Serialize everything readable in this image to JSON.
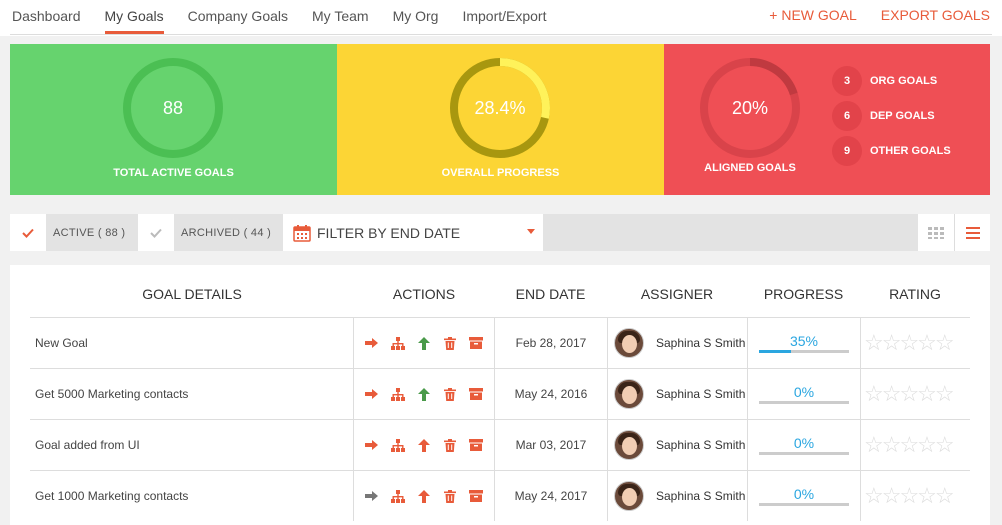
{
  "nav": {
    "tabs": [
      {
        "label": "Dashboard"
      },
      {
        "label": "My Goals"
      },
      {
        "label": "Company Goals"
      },
      {
        "label": "My Team"
      },
      {
        "label": "My Org"
      },
      {
        "label": "Import/Export"
      }
    ],
    "active_tab": "My Goals",
    "new_goal_label": "+ NEW GOAL",
    "export_goals_label": "EXPORT GOALS",
    "accent_color": "#e85b3a"
  },
  "stats": {
    "total_active": {
      "value": "88",
      "caption": "TOTAL ACTIVE GOALS",
      "color": "#66d36e"
    },
    "overall_progress": {
      "value": "28.4%",
      "fraction": 0.284,
      "caption": "OVERALL PROGRESS",
      "color": "#fcd535"
    },
    "aligned": {
      "value": "20%",
      "fraction": 0.2,
      "caption": "ALIGNED GOALS",
      "color": "#ef4f55"
    },
    "aligned_breakdown": [
      {
        "count": "3",
        "label": "ORG GOALS"
      },
      {
        "count": "6",
        "label": "DEP GOALS"
      },
      {
        "count": "9",
        "label": "OTHER GOALS"
      }
    ]
  },
  "filters": {
    "active_label": "ACTIVE ( 88 )",
    "archived_label": "ARCHIVED ( 44 )",
    "date_filter_label": "FILTER BY END DATE"
  },
  "table": {
    "headers": {
      "details": "GOAL DETAILS",
      "actions": "ACTIONS",
      "end_date": "END DATE",
      "assigner": "ASSIGNER",
      "progress": "PROGRESS",
      "rating": "RATING"
    },
    "rows": [
      {
        "goal": "New Goal",
        "end_date": "Feb 28, 2017",
        "assigner": "Saphina S Smith",
        "progress": "35%",
        "progress_fraction": 0.35,
        "rating": 0,
        "arrow_color": "#4a9a4a"
      },
      {
        "goal": "Get 5000 Marketing contacts",
        "end_date": "May 24, 2016",
        "assigner": "Saphina S Smith",
        "progress": "0%",
        "progress_fraction": 0,
        "rating": 0,
        "arrow_color": "#4a9a4a"
      },
      {
        "goal": "Goal added from UI",
        "end_date": "Mar 03, 2017",
        "assigner": "Saphina S Smith",
        "progress": "0%",
        "progress_fraction": 0,
        "rating": 0,
        "arrow_color": "#e85b3a"
      },
      {
        "goal": "Get 1000 Marketing contacts",
        "end_date": "May 24, 2017",
        "assigner": "Saphina S Smith",
        "progress": "0%",
        "progress_fraction": 0,
        "rating": 0,
        "arrow_color": "#e85b3a"
      }
    ]
  }
}
